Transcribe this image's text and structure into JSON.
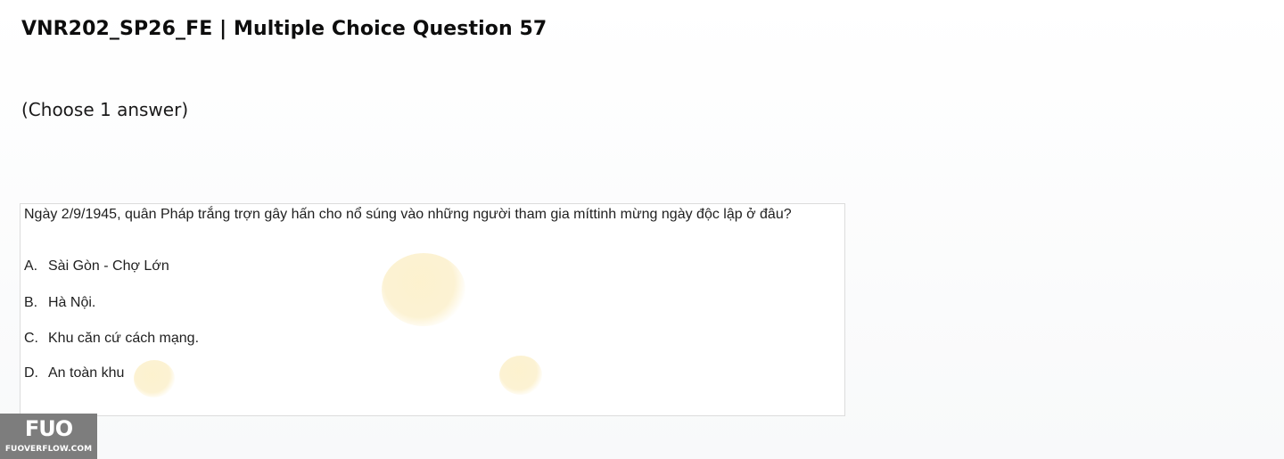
{
  "header": {
    "title": "VNR202_SP26_FE | Multiple Choice Question 57",
    "instruction": "(Choose 1 answer)"
  },
  "question": {
    "text": "Ngày 2/9/1945, quân Pháp trắng trợn gây hấn cho nổ súng vào những người tham gia míttinh mừng ngày độc lập ở đâu?",
    "options": [
      {
        "letter": "A.",
        "text": "Sài Gòn - Chợ Lớn"
      },
      {
        "letter": "B.",
        "text": "Hà Nội."
      },
      {
        "letter": "C.",
        "text": "Khu căn cứ cách mạng."
      },
      {
        "letter": "D.",
        "text": "An toàn khu"
      }
    ]
  },
  "watermark": {
    "logo": "FUO",
    "site": "FUOVERFLOW.COM"
  },
  "colors": {
    "logo_background": "#7d7d7d",
    "card_border": "#dcdcdc"
  }
}
